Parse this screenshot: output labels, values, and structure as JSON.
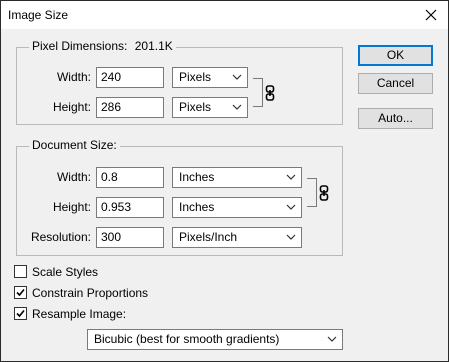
{
  "window": {
    "title": "Image Size"
  },
  "pixel_dimensions": {
    "legend": "Pixel Dimensions:",
    "size": "201.1K",
    "width_label": "Width:",
    "width_value": "240",
    "width_unit": "Pixels",
    "height_label": "Height:",
    "height_value": "286",
    "height_unit": "Pixels"
  },
  "document_size": {
    "legend": "Document Size:",
    "width_label": "Width:",
    "width_value": "0.8",
    "width_unit": "Inches",
    "height_label": "Height:",
    "height_value": "0.953",
    "height_unit": "Inches",
    "resolution_label": "Resolution:",
    "resolution_value": "300",
    "resolution_unit": "Pixels/Inch"
  },
  "options": {
    "scale_styles": {
      "label": "Scale Styles",
      "checked": false
    },
    "constrain_proportions": {
      "label": "Constrain Proportions",
      "checked": true
    },
    "resample_image": {
      "label": "Resample Image:",
      "checked": true
    },
    "resample_method": "Bicubic (best for smooth gradients)"
  },
  "buttons": {
    "ok": "OK",
    "cancel": "Cancel",
    "auto": "Auto..."
  },
  "icons": {
    "close": "close-icon",
    "link": "chain-link-icon",
    "dropdown": "chevron-down-icon",
    "check": "checkmark-icon"
  },
  "colors": {
    "default_button_border": "#0078d7",
    "dialog_background": "#f0f0f0"
  }
}
